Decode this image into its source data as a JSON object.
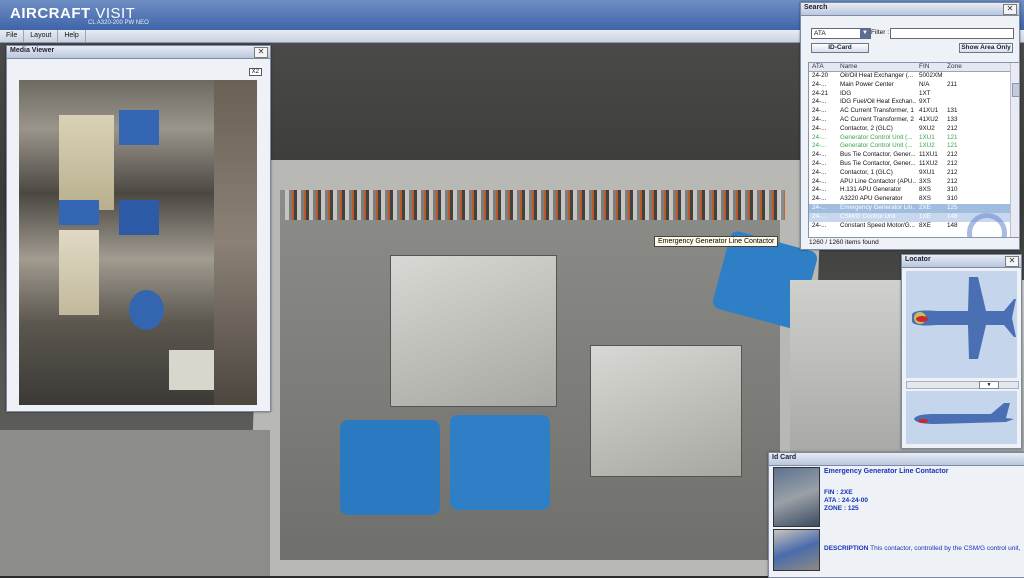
{
  "app": {
    "title_bold": "AIRCRAFT",
    "title_light": " VISIT",
    "subtitle": "CL A320-200 PW NEO"
  },
  "menu": [
    "File",
    "Layout",
    "Help"
  ],
  "tooltip": "Emergency Generator Line Contactor",
  "media_viewer": {
    "title": "Media Viewer",
    "close": "✕",
    "zoom_button": "X2"
  },
  "search": {
    "title": "Search",
    "close": "✕",
    "mode_selected": "ATA",
    "filter_label": "Filter :",
    "filter_value": "",
    "id_card_button": "ID-Card",
    "show_area_button": "Show Area Only",
    "columns": [
      "ATA",
      "Name",
      "FIN",
      "Zone"
    ],
    "rows": [
      {
        "ata": "24-20",
        "name": "Oil/Oil Heat Exchanger (...",
        "fin": "5002XM",
        "zone": "",
        "style": ""
      },
      {
        "ata": "24-...",
        "name": "Main Power Center",
        "fin": "N/A",
        "zone": "211",
        "style": ""
      },
      {
        "ata": "24-21",
        "name": "IDG",
        "fin": "1XT",
        "zone": "",
        "style": ""
      },
      {
        "ata": "24-...",
        "name": "IDG Fuel/Oil Heat Exchan...",
        "fin": "9XT",
        "zone": "",
        "style": ""
      },
      {
        "ata": "24-...",
        "name": "AC Current Transformer, 1",
        "fin": "41XU1",
        "zone": "131",
        "style": ""
      },
      {
        "ata": "24-...",
        "name": "AC Current Transformer, 2",
        "fin": "41XU2",
        "zone": "133",
        "style": ""
      },
      {
        "ata": "24-...",
        "name": "Contactor, 2 (GLC)",
        "fin": "9XU2",
        "zone": "212",
        "style": ""
      },
      {
        "ata": "24-...",
        "name": "Generator Control Unit (...",
        "fin": "1XU1",
        "zone": "121",
        "style": "green"
      },
      {
        "ata": "24-...",
        "name": "Generator Control Unit (...",
        "fin": "1XU2",
        "zone": "121",
        "style": "green"
      },
      {
        "ata": "24-...",
        "name": "Bus Tie Contactor, Gener...",
        "fin": "11XU1",
        "zone": "212",
        "style": ""
      },
      {
        "ata": "24-...",
        "name": "Bus Tie Contactor, Gener...",
        "fin": "11XU2",
        "zone": "212",
        "style": ""
      },
      {
        "ata": "24-...",
        "name": "Contactor, 1 (GLC)",
        "fin": "9XU1",
        "zone": "212",
        "style": ""
      },
      {
        "ata": "24-...",
        "name": "APU Line Contactor (APU...",
        "fin": "3XS",
        "zone": "212",
        "style": ""
      },
      {
        "ata": "24-...",
        "name": "H.131 APU Generator",
        "fin": "8XS",
        "zone": "310",
        "style": ""
      },
      {
        "ata": "24-...",
        "name": "A3220 APU Generator",
        "fin": "8XS",
        "zone": "310",
        "style": ""
      },
      {
        "ata": "24-...",
        "name": "Emergency Generator Lin...",
        "fin": "2XE",
        "zone": "125",
        "style": "sel-a"
      },
      {
        "ata": "24-...",
        "name": "CSM/G Control Unit",
        "fin": "1XE",
        "zone": "148",
        "style": "sel-b"
      },
      {
        "ata": "24-...",
        "name": "Constant Speed Motor/G...",
        "fin": "8XE",
        "zone": "148",
        "style": ""
      }
    ],
    "count_text": "1260 / 1260 items found"
  },
  "locator": {
    "title": "Locator",
    "close": "✕"
  },
  "id_card": {
    "title": "Id Card",
    "name": "Emergency Generator Line Contactor",
    "fin": "FIN : 2XE",
    "ata": "ATA : 24-24-00",
    "zone": "ZONE : 125",
    "description_label": "DESCRIPTION",
    "description": "This contactor, controlled by the CSM/G control unit,"
  },
  "colors": {
    "titlebar": "#3e64a8",
    "highlight_green": "#3aa64a",
    "id_card_text": "#1633b8",
    "aircraft_blue": "#4a6fb3",
    "locator_marker": "#cc2a2a"
  }
}
